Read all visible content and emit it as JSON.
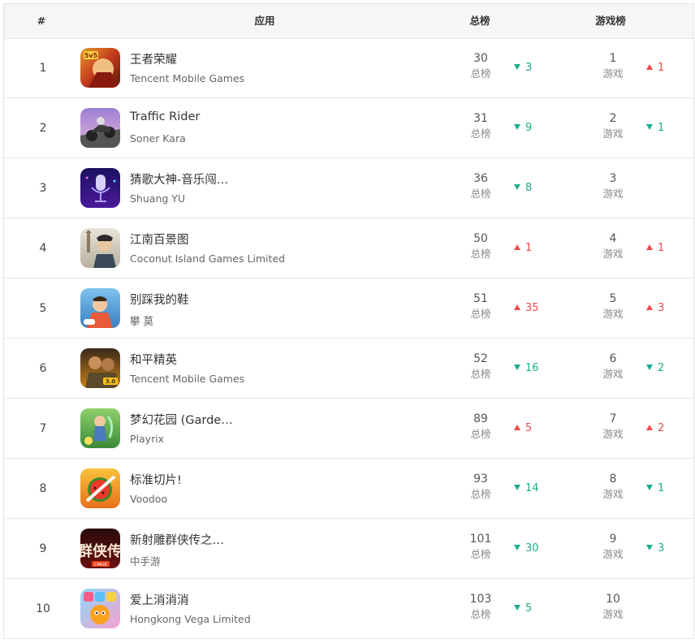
{
  "header": {
    "rank": "#",
    "app": "应用",
    "total": "总榜",
    "game": "游戏榜"
  },
  "colors": {
    "up": "#ec4b4b",
    "down": "#1aad8c"
  },
  "rows": [
    {
      "rank": "1",
      "name": "王者荣耀",
      "dev": "Tencent Mobile Games",
      "icon": "honor-of-kings-icon",
      "total": "30",
      "total_label": "总榜",
      "total_dir": "down",
      "total_change": "3",
      "game": "1",
      "game_label": "游戏",
      "game_dir": "up",
      "game_change": "1"
    },
    {
      "rank": "2",
      "name": "Traffic Rider",
      "dev": "Soner Kara",
      "icon": "traffic-rider-icon",
      "total": "31",
      "total_label": "总榜",
      "total_dir": "down",
      "total_change": "9",
      "game": "2",
      "game_label": "游戏",
      "game_dir": "down",
      "game_change": "1"
    },
    {
      "rank": "3",
      "name": "猜歌大神-音乐闯…",
      "dev": "Shuang YU",
      "icon": "microphone-icon",
      "total": "36",
      "total_label": "总榜",
      "total_dir": "down",
      "total_change": "8",
      "game": "3",
      "game_label": "游戏",
      "game_dir": "",
      "game_change": ""
    },
    {
      "rank": "4",
      "name": "江南百景图",
      "dev": "Coconut Island Games Limited",
      "icon": "jiangnan-icon",
      "total": "50",
      "total_label": "总榜",
      "total_dir": "up",
      "total_change": "1",
      "game": "4",
      "game_label": "游戏",
      "game_dir": "up",
      "game_change": "1"
    },
    {
      "rank": "5",
      "name": "别踩我的鞋",
      "dev": "攀 莫",
      "icon": "shoes-game-icon",
      "total": "51",
      "total_label": "总榜",
      "total_dir": "up",
      "total_change": "35",
      "game": "5",
      "game_label": "游戏",
      "game_dir": "up",
      "game_change": "3"
    },
    {
      "rank": "6",
      "name": "和平精英",
      "dev": "Tencent Mobile Games",
      "icon": "peace-elite-icon",
      "total": "52",
      "total_label": "总榜",
      "total_dir": "down",
      "total_change": "16",
      "game": "6",
      "game_label": "游戏",
      "game_dir": "down",
      "game_change": "2"
    },
    {
      "rank": "7",
      "name": "梦幻花园 (Garde…",
      "dev": "Playrix",
      "icon": "gardenscapes-icon",
      "total": "89",
      "total_label": "总榜",
      "total_dir": "up",
      "total_change": "5",
      "game": "7",
      "game_label": "游戏",
      "game_dir": "up",
      "game_change": "2"
    },
    {
      "rank": "8",
      "name": "标准切片!",
      "dev": "Voodoo",
      "icon": "fruit-slice-icon",
      "total": "93",
      "total_label": "总榜",
      "total_dir": "down",
      "total_change": "14",
      "game": "8",
      "game_label": "游戏",
      "game_dir": "down",
      "game_change": "1"
    },
    {
      "rank": "9",
      "name": "新射雕群侠传之…",
      "dev": "中手游",
      "icon": "heroes-legend-icon",
      "total": "101",
      "total_label": "总榜",
      "total_dir": "down",
      "total_change": "30",
      "game": "9",
      "game_label": "游戏",
      "game_dir": "down",
      "game_change": "3"
    },
    {
      "rank": "10",
      "name": "爱上消消消",
      "dev": "Hongkong Vega Limited",
      "icon": "match-candy-icon",
      "total": "103",
      "total_label": "总榜",
      "total_dir": "down",
      "total_change": "5",
      "game": "10",
      "game_label": "游戏",
      "game_dir": "",
      "game_change": ""
    }
  ]
}
